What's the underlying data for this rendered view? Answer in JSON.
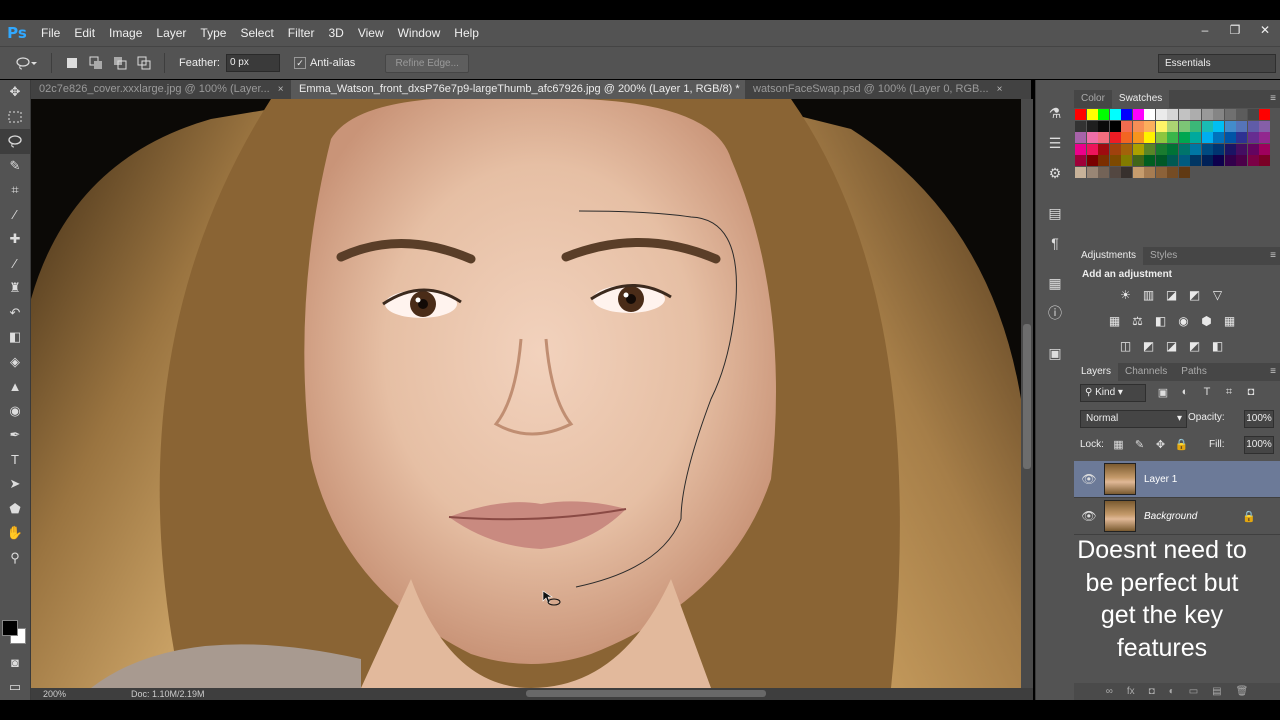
{
  "app": {
    "logo": "Ps"
  },
  "menu": [
    "File",
    "Edit",
    "Image",
    "Layer",
    "Type",
    "Select",
    "Filter",
    "3D",
    "View",
    "Window",
    "Help"
  ],
  "window_controls": [
    "–",
    "❐",
    "✕"
  ],
  "options": {
    "feather_label": "Feather:",
    "feather_value": "0 px",
    "antialias_label": "Anti-alias",
    "antialias_checked": "✓",
    "refine_edge": "Refine Edge...",
    "workspace": "Essentials"
  },
  "tabs": [
    {
      "label": "02c7e826_cover.xxxlarge.jpg @ 100% (Layer...",
      "close": "×"
    },
    {
      "label": "Emma_Watson_front_dxsP76e7p9-largeThumb_afc67926.jpg @ 200% (Layer 1, RGB/8) *",
      "close": "×"
    },
    {
      "label": "watsonFaceSwap.psd @ 100% (Layer 0, RGB...",
      "close": "×"
    }
  ],
  "status": {
    "zoom": "200%",
    "doc": "Doc: 1.10M/2.19M"
  },
  "swatches_panel": {
    "tabs": [
      "Color",
      "Swatches"
    ]
  },
  "swatch_colors": [
    "#ff0000",
    "#ffff00",
    "#00ff00",
    "#00ffff",
    "#0000ff",
    "#ff00ff",
    "#ffffff",
    "#ebebeb",
    "#d6d6d6",
    "#c2c2c2",
    "#adadad",
    "#999999",
    "#858585",
    "#707070",
    "#5c5c5c",
    "#474747",
    "#ff0000",
    "#333333",
    "#1f1f1f",
    "#0a0a0a",
    "#000000",
    "#f26c4f",
    "#f68e56",
    "#fbaf5c",
    "#fff467",
    "#acd372",
    "#7cc576",
    "#3bb878",
    "#1abbb4",
    "#00bff3",
    "#438ccb",
    "#5574b9",
    "#605ca8",
    "#855fa8",
    "#a763a9",
    "#ef6ea8",
    "#f16d7e",
    "#ed1c24",
    "#f26522",
    "#f7941d",
    "#fff200",
    "#8dc63f",
    "#39b54a",
    "#00a651",
    "#00a99d",
    "#00aeef",
    "#0072bc",
    "#0054a6",
    "#2e3192",
    "#662d91",
    "#92278f",
    "#ec008c",
    "#ed145b",
    "#9e0b0f",
    "#a0410d",
    "#a3620a",
    "#aba000",
    "#598527",
    "#197b30",
    "#007236",
    "#00746b",
    "#0076a3",
    "#004a80",
    "#003471",
    "#1b1464",
    "#440e62",
    "#630460",
    "#9e005d",
    "#9e0039",
    "#790000",
    "#7b2e00",
    "#7d4900",
    "#827b00",
    "#406618",
    "#005e20",
    "#005826",
    "#005952",
    "#005b7f",
    "#003663",
    "#002157",
    "#0d004c",
    "#32004b",
    "#4b0049",
    "#7b0046",
    "#7a0026",
    "#c7b299",
    "#998675",
    "#736357",
    "#534741",
    "#37302d",
    "#c69c6d",
    "#a67c52",
    "#8c6239",
    "#754c24",
    "#603913"
  ],
  "adjustments_panel": {
    "tabs": [
      "Adjustments",
      "Styles"
    ],
    "title": "Add an adjustment"
  },
  "adjustment_icons": [
    [
      "☀",
      "▥",
      "◪",
      "◩",
      "▽"
    ],
    [
      "▦",
      "⚖",
      "◧",
      "◉",
      "⬢",
      "▦"
    ],
    [
      "◫",
      "◩",
      "◪",
      "◩",
      "◧"
    ]
  ],
  "layers_panel": {
    "tabs": [
      "Layers",
      "Channels",
      "Paths"
    ],
    "kind": "Kind",
    "blend_mode": "Normal",
    "opacity_label": "Opacity:",
    "opacity": "100%",
    "lock_label": "Lock:",
    "fill_label": "Fill:",
    "fill": "100%",
    "layers": [
      {
        "name": "Layer 1",
        "selected": true
      },
      {
        "name": "Background",
        "selected": false,
        "locked": true
      }
    ],
    "footer_icons": [
      "∞",
      "fx",
      "◘",
      "◐",
      "▭",
      "▤",
      "🗑"
    ]
  },
  "caption": "Doesnt need to be perfect but get the key features"
}
